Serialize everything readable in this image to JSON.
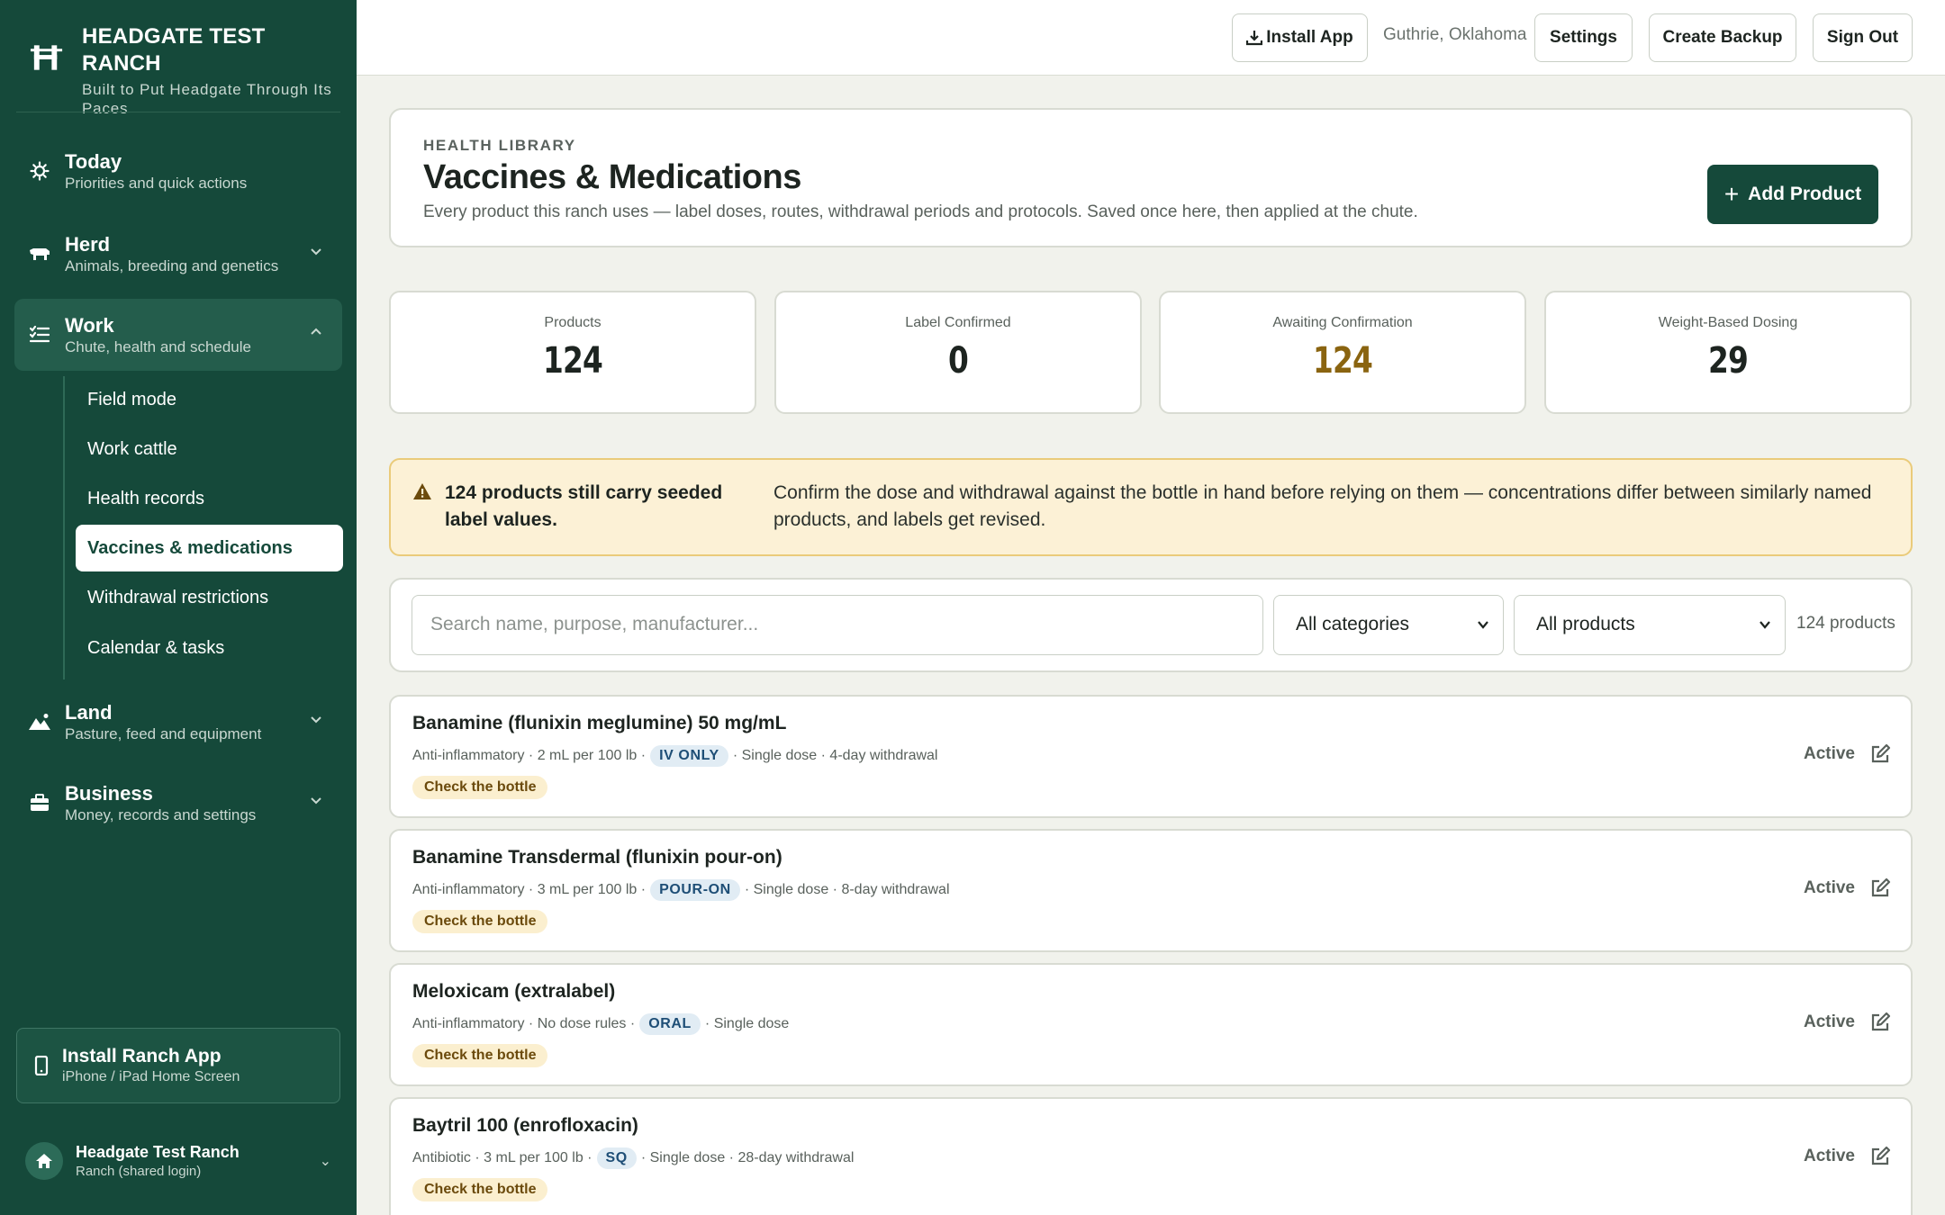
{
  "sidebar": {
    "brand_title": "HEADGATE TEST RANCH",
    "brand_sub": "Built to Put Headgate Through Its Paces",
    "nav": [
      {
        "title": "Today",
        "sub": "Priorities and quick actions"
      },
      {
        "title": "Herd",
        "sub": "Animals, breeding and genetics"
      },
      {
        "title": "Work",
        "sub": "Chute, health and schedule"
      },
      {
        "title": "Land",
        "sub": "Pasture, feed and equipment"
      },
      {
        "title": "Business",
        "sub": "Money, records and settings"
      }
    ],
    "work_items": [
      "Field mode",
      "Work cattle",
      "Health records",
      "Vaccines & medications",
      "Withdrawal restrictions",
      "Calendar & tasks"
    ],
    "install_title": "Install Ranch App",
    "install_sub": "iPhone / iPad Home Screen",
    "account_name": "Headgate Test Ranch",
    "account_role": "Ranch (shared login)"
  },
  "topbar": {
    "install_label": "Install App",
    "location": "Guthrie, Oklahoma",
    "settings_label": "Settings",
    "backup_label": "Create Backup",
    "signout_label": "Sign Out"
  },
  "header": {
    "eyebrow": "HEALTH LIBRARY",
    "title": "Vaccines & Medications",
    "description": "Every product this ranch uses — label doses, routes, withdrawal periods and protocols. Saved once here, then applied at the chute.",
    "add_label": "Add Product"
  },
  "stats": [
    {
      "label": "Products",
      "value": "124",
      "color": "#1d2420"
    },
    {
      "label": "Label Confirmed",
      "value": "0",
      "color": "#1d2420"
    },
    {
      "label": "Awaiting Confirmation",
      "value": "124",
      "color": "#8a6410"
    },
    {
      "label": "Weight-Based Dosing",
      "value": "29",
      "color": "#1d2420"
    }
  ],
  "alert": {
    "bold": "124 products still carry seeded label values.",
    "text": "Confirm the dose and withdrawal against the bottle in hand before relying on them — concentrations differ between similarly named products, and labels get revised."
  },
  "filters": {
    "search_placeholder": "Search name, purpose, manufacturer...",
    "category": "All categories",
    "status": "All products",
    "count": "124 products"
  },
  "products": [
    {
      "name": "Banamine (flunixin meglumine) 50 mg/mL",
      "meta_before": "Anti-inflammatory · 2 mL per 100 lb ·",
      "route": "IV ONLY",
      "meta_after": "· Single dose · 4-day withdrawal",
      "check": "Check the bottle",
      "status": "Active"
    },
    {
      "name": "Banamine Transdermal (flunixin pour-on)",
      "meta_before": "Anti-inflammatory · 3 mL per 100 lb ·",
      "route": "POUR-ON",
      "meta_after": "· Single dose · 8-day withdrawal",
      "check": "Check the bottle",
      "status": "Active"
    },
    {
      "name": "Meloxicam (extralabel)",
      "meta_before": "Anti-inflammatory · No dose rules ·",
      "route": "ORAL",
      "meta_after": "· Single dose",
      "check": "Check the bottle",
      "status": "Active"
    },
    {
      "name": "Baytril 100 (enrofloxacin)",
      "meta_before": "Antibiotic · 3 mL per 100 lb ·",
      "route": "SQ",
      "meta_after": "· Single dose · 28-day withdrawal",
      "check": "Check the bottle",
      "status": "Active"
    }
  ]
}
